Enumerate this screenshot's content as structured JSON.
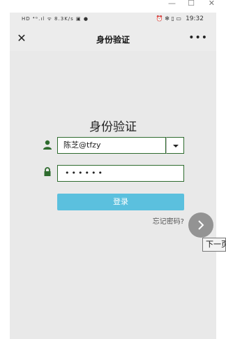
{
  "window_controls": {
    "minimize": "—",
    "maximize": "☐",
    "close": "✕"
  },
  "statusbar": {
    "left_icons": "HD ⁴ᴳ.ıl ᯤ 8.3K/s ▣ ●",
    "right_icons": "⏰ ✻ ▯ ▭",
    "time": "19:32"
  },
  "navbar": {
    "title": "身份验证",
    "close_icon": "✕",
    "more_icon": "•••"
  },
  "login": {
    "heading": "身份验证",
    "username_value": "陈芝@tfzy",
    "password_value": "••••••",
    "login_button": "登录",
    "forgot_password": "忘记密码?"
  },
  "overlay": {
    "next_tooltip": "下一页"
  },
  "colors": {
    "accent_green": "#2e6b2e",
    "button_blue": "#5bc0de",
    "background": "#e9e9e9"
  }
}
